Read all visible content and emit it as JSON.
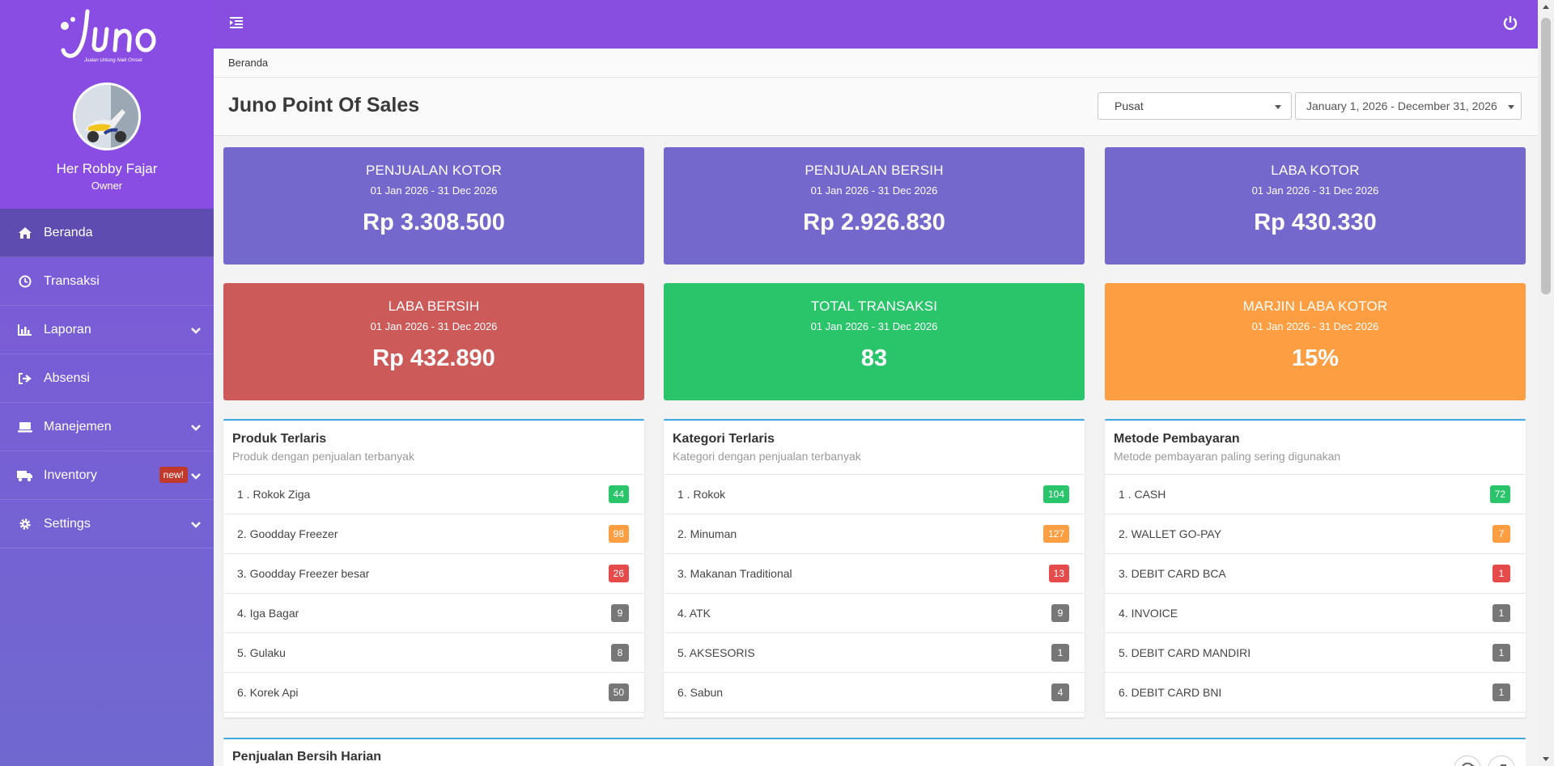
{
  "brand": {
    "name": "Juno",
    "tagline": "Jualan Untung Naik Omset"
  },
  "user": {
    "name": "Her Robby Fajar",
    "role": "Owner"
  },
  "sidebar": {
    "items": [
      {
        "label": "Beranda",
        "icon": "home-icon"
      },
      {
        "label": "Transaksi",
        "icon": "clock-icon"
      },
      {
        "label": "Laporan",
        "icon": "chart-icon"
      },
      {
        "label": "Absensi",
        "icon": "sign-out-icon"
      },
      {
        "label": "Manejemen",
        "icon": "laptop-icon"
      },
      {
        "label": "Inventory",
        "icon": "truck-icon",
        "badge": "new!"
      },
      {
        "label": "Settings",
        "icon": "gear-icon"
      }
    ]
  },
  "breadcrumb": "Beranda",
  "page_title": "Juno Point Of Sales",
  "filters": {
    "branch": "Pusat",
    "date_range": "January 1, 2026 - December 31, 2026"
  },
  "stats": [
    {
      "title": "PENJUALAN KOTOR",
      "date": "01 Jan 2026 - 31 Dec 2026",
      "value": "Rp 3.308.500",
      "color": "#7468cc"
    },
    {
      "title": "PENJUALAN BERSIH",
      "date": "01 Jan 2026 - 31 Dec 2026",
      "value": "Rp 2.926.830",
      "color": "#7468cc"
    },
    {
      "title": "LABA KOTOR",
      "date": "01 Jan 2026 - 31 Dec 2026",
      "value": "Rp 430.330",
      "color": "#7468cc"
    },
    {
      "title": "LABA BERSIH",
      "date": "01 Jan 2026 - 31 Dec 2026",
      "value": "Rp 432.890",
      "color": "#cc5a59"
    },
    {
      "title": "TOTAL TRANSAKSI",
      "date": "01 Jan 2026 - 31 Dec 2026",
      "value": "83",
      "color": "#2ac46b"
    },
    {
      "title": "MARJIN LABA KOTOR",
      "date": "01 Jan 2026 - 31 Dec 2026",
      "value": "15%",
      "color": "#fd9e42"
    }
  ],
  "panels": [
    {
      "title": "Produk Terlaris",
      "subtitle": "Produk dengan penjualan terbanyak",
      "rows": [
        {
          "label": "1 . Rokok Ziga",
          "count": "44",
          "color": "#2ac46b"
        },
        {
          "label": "2. Goodday Freezer",
          "count": "98",
          "color": "#fd9e42"
        },
        {
          "label": "3. Goodday Freezer besar",
          "count": "26",
          "color": "#e54b4b"
        },
        {
          "label": "4. Iga Bagar",
          "count": "9",
          "color": "#777777"
        },
        {
          "label": "5. Gulaku",
          "count": "8",
          "color": "#777777"
        },
        {
          "label": "6. Korek Api",
          "count": "50",
          "color": "#777777"
        }
      ]
    },
    {
      "title": "Kategori Terlaris",
      "subtitle": "Kategori dengan penjualan terbanyak",
      "rows": [
        {
          "label": "1 . Rokok",
          "count": "104",
          "color": "#2ac46b"
        },
        {
          "label": "2. Minuman",
          "count": "127",
          "color": "#fd9e42"
        },
        {
          "label": "3. Makanan Traditional",
          "count": "13",
          "color": "#e54b4b"
        },
        {
          "label": "4. ATK",
          "count": "9",
          "color": "#777777"
        },
        {
          "label": "5. AKSESORIS",
          "count": "1",
          "color": "#777777"
        },
        {
          "label": "6. Sabun",
          "count": "4",
          "color": "#777777"
        }
      ]
    },
    {
      "title": "Metode Pembayaran",
      "subtitle": "Metode pembayaran paling sering digunakan",
      "rows": [
        {
          "label": "1 . CASH",
          "count": "72",
          "color": "#2ac46b"
        },
        {
          "label": "2. WALLET GO-PAY",
          "count": "7",
          "color": "#fd9e42"
        },
        {
          "label": "3. DEBIT CARD BCA",
          "count": "1",
          "color": "#e54b4b"
        },
        {
          "label": "4. INVOICE",
          "count": "1",
          "color": "#777777"
        },
        {
          "label": "5. DEBIT CARD MANDIRI",
          "count": "1",
          "color": "#777777"
        },
        {
          "label": "6. DEBIT CARD BNI",
          "count": "1",
          "color": "#777777"
        }
      ]
    }
  ],
  "bottom_panel": {
    "title": "Penjualan Bersih Harian"
  }
}
